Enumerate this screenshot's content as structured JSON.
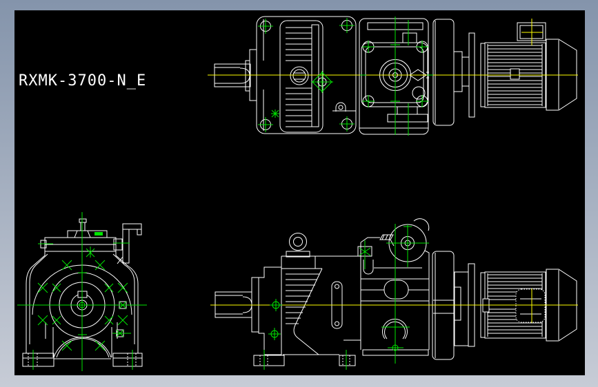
{
  "window": {
    "colors": {
      "frame-top": "#8494ab",
      "frame-bottom": "#c7ccd6",
      "background": "#000000",
      "line": "#ffffff",
      "centerline": "#ffff00",
      "marker": "#00e600"
    }
  },
  "drawing": {
    "label": "RXMK-3700-N_E"
  }
}
